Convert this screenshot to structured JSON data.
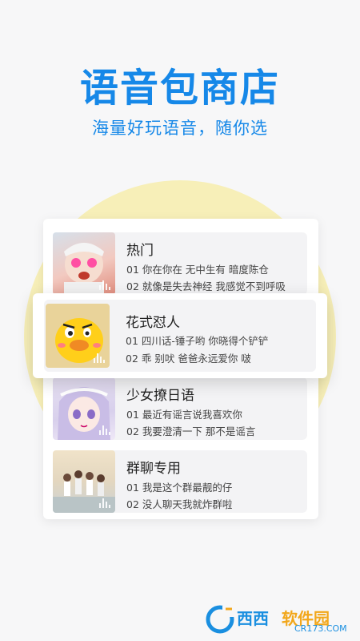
{
  "header": {
    "title": "语音包商店",
    "subtitle": "海量好玩语音，随你选"
  },
  "packs": [
    {
      "name": "热门",
      "lines": [
        "01 你在你在 无中生有 暗度陈仓",
        "02 就像是失去神经 我感觉不到呼吸"
      ]
    },
    {
      "name": "花式怼人",
      "lines": [
        "01 四川话-锤子哟 你晓得个铲铲",
        "02 乖 别吠 爸爸永远爱你 啵"
      ]
    },
    {
      "name": "少女撩日语",
      "lines": [
        "01 最近有谣言说我喜欢你",
        "02 我要澄清一下 那不是谣言"
      ]
    },
    {
      "name": "群聊专用",
      "lines": [
        "01 我是这个群最靓的仔",
        "02 没人聊天我就炸群啦"
      ]
    }
  ],
  "watermark": {
    "brand": "西西",
    "brand2": "软件园",
    "url": "CR173.COM"
  },
  "colors": {
    "accent": "#1688e8",
    "sun": "#f7efb8"
  }
}
